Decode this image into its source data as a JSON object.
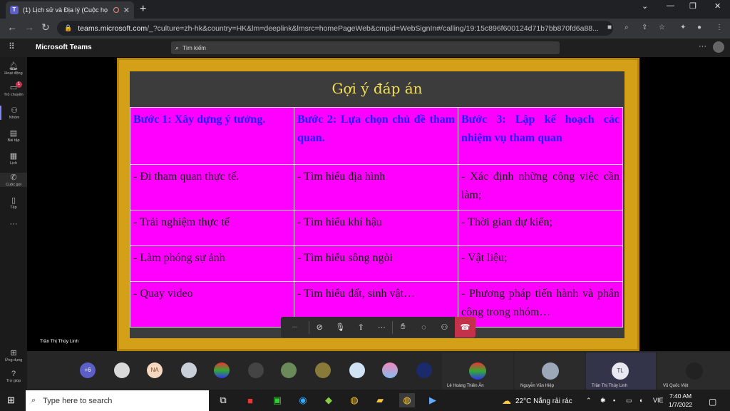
{
  "browser": {
    "tab_title": "(1) Lịch sử và Địa lý (Cuộc họ",
    "tab_icon": "teams-icon",
    "url_host": "teams.microsoft.com",
    "url_path": "/_?culture=zh-hk&country=HK&lm=deeplink&lmsrc=homePageWeb&cmpid=WebSignIn#/calling/19:15c896f600124d71b7bb870fd6a88..."
  },
  "teams": {
    "app_name": "Microsoft Teams",
    "search_placeholder": "Tìm kiếm",
    "rail": [
      {
        "label": "Hoạt động",
        "icon": "bell-icon"
      },
      {
        "label": "Trò chuyện",
        "icon": "chat-icon",
        "badge": "1"
      },
      {
        "label": "Nhóm",
        "icon": "teams-icon"
      },
      {
        "label": "Bài tập",
        "icon": "assignments-icon"
      },
      {
        "label": "Lịch",
        "icon": "calendar-icon"
      },
      {
        "label": "Cuộc gọi",
        "icon": "phone-icon"
      },
      {
        "label": "Tệp",
        "icon": "file-icon"
      }
    ],
    "rail_bottom": [
      {
        "label": "Ứng dụng",
        "icon": "apps-icon"
      },
      {
        "label": "Trợ giúp",
        "icon": "help-icon"
      }
    ]
  },
  "slide": {
    "title": "Gợi ý đáp án",
    "headers": [
      "Bước 1: Xây dựng ý tưởng.",
      "Bước 2: Lựa chọn chủ đề tham quan.",
      "Bước 3: Lập kế hoạch các nhiệm vụ tham quan"
    ],
    "rows": [
      [
        "- Đi tham quan thực tế.",
        "- Tìm hiểu địa hình",
        "- Xác định những công việc cần làm;"
      ],
      [
        "- Trải nghiệm thực tế",
        "- Tìm hiểu khí hậu",
        "- Thời gian dự kiến;"
      ],
      [
        "- Làm phóng sự ảnh",
        "- Tìm hiểu sông ngòi",
        "- Vật liệu;"
      ],
      [
        "- Quay video",
        "- Tìm hiểu đất, sinh vật…",
        "- Phương pháp tiến hành và phân công trong nhóm…"
      ]
    ]
  },
  "call": {
    "presenter": "Trần Thị Thúy Linh",
    "overflow_count": "+6",
    "initials_na": "NA",
    "participants": [
      {
        "name": "Lê Hoàng Thiên Ân"
      },
      {
        "name": "Nguyễn Văn Hiệp"
      },
      {
        "name": "Trần Thị Thúy Linh",
        "initials": "TL"
      },
      {
        "name": "Vũ Quốc Việt"
      }
    ]
  },
  "taskbar": {
    "search_placeholder": "Type here to search",
    "weather": "22°C  Nắng rải rác",
    "lang": "VIE",
    "time": "7:40 AM",
    "date": "1/7/2022"
  }
}
